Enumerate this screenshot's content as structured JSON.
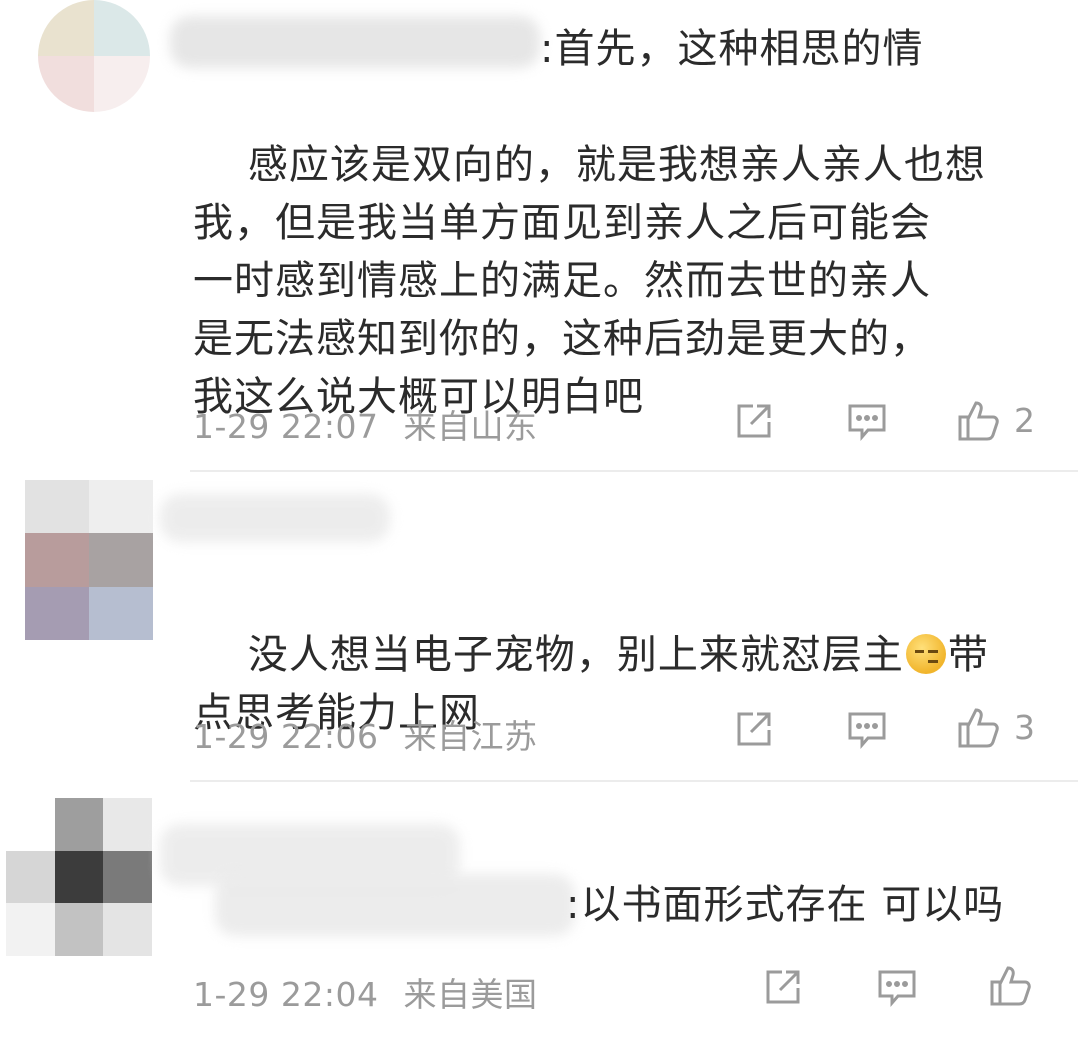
{
  "comments": [
    {
      "text": ":首先，这种相思的情\n感应该是双向的，就是我想亲人亲人也想\n我，但是我当单方面见到亲人之后可能会\n一时感到情感上的满足。然而去世的亲人\n是无法感知到你的，这种后劲是更大的，\n我这么说大概可以明白吧",
      "time": "1-29 22:07",
      "location": "来自山东",
      "likes": "2"
    },
    {
      "text_before": "没人想当电子宠物，别上来就怼层主",
      "emoji": "awkward-face-emoji",
      "text_after": "带\n点思考能力上网",
      "time": "1-29 22:06",
      "location": "来自江苏",
      "likes": "3"
    },
    {
      "text": ":以书面形式存在 可以吗",
      "time": "1-29 22:04",
      "location": "来自美国",
      "likes": ""
    }
  ],
  "icons": {
    "share": "share-icon",
    "reply": "comment-icon",
    "like": "thumbs-up-icon"
  },
  "colors": {
    "text": "#2b2b2b",
    "meta": "#9b9b9b",
    "divider": "#ececec"
  }
}
